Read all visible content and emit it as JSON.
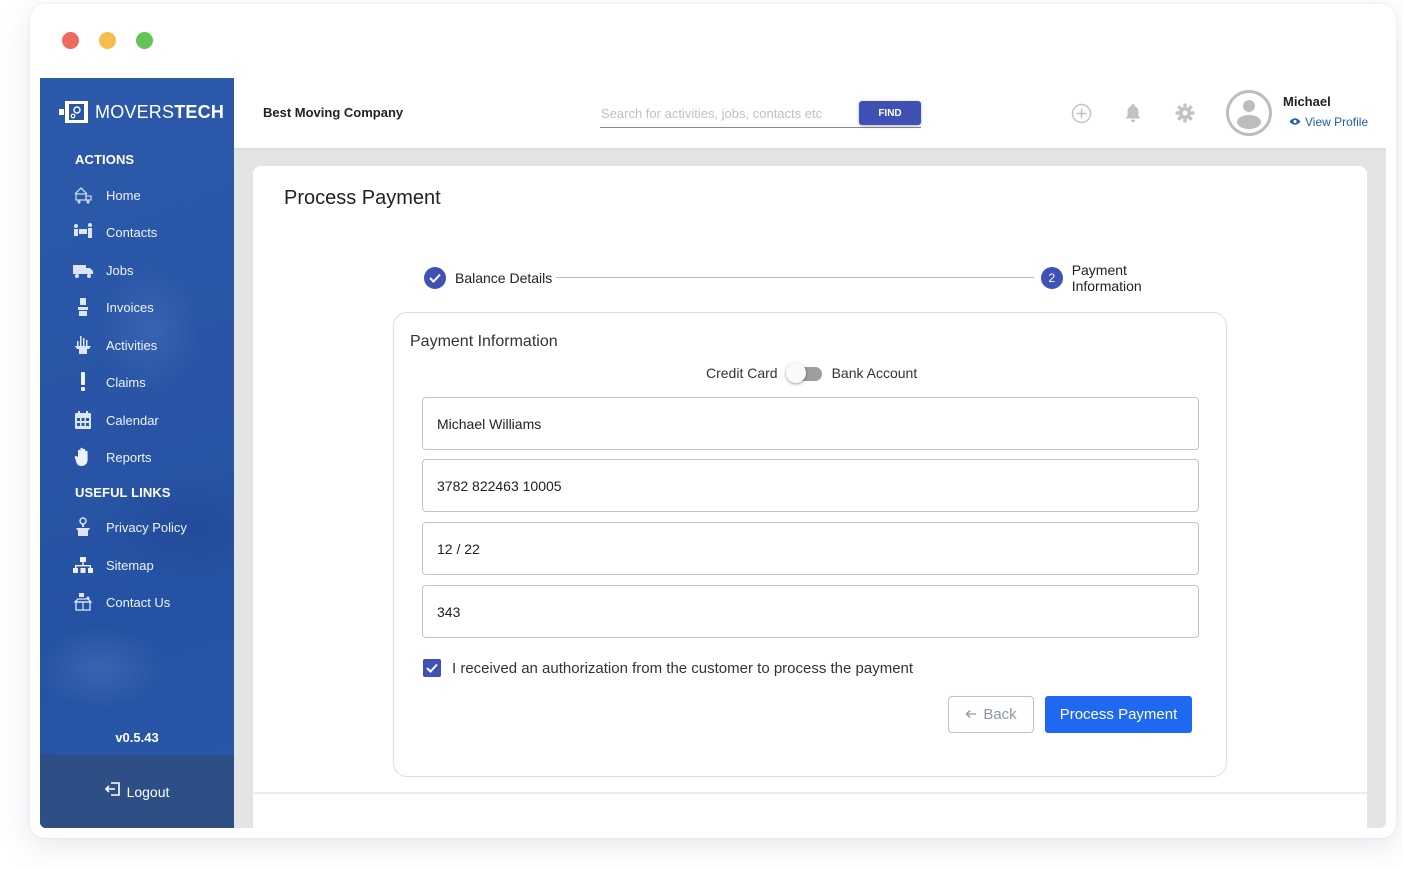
{
  "window": {
    "controls": [
      "close",
      "minimize",
      "maximize"
    ]
  },
  "brand": {
    "name_light": "MOVERS",
    "name_bold": "TECH"
  },
  "sidebar": {
    "actions_title": "ACTIONS",
    "actions": [
      {
        "label": "Home",
        "icon": "home-truck-icon"
      },
      {
        "label": "Contacts",
        "icon": "contacts-movers-icon"
      },
      {
        "label": "Jobs",
        "icon": "truck-icon"
      },
      {
        "label": "Invoices",
        "icon": "invoice-box-icon"
      },
      {
        "label": "Activities",
        "icon": "activities-icon"
      },
      {
        "label": "Claims",
        "icon": "exclamation-icon"
      },
      {
        "label": "Calendar",
        "icon": "calendar-icon"
      },
      {
        "label": "Reports",
        "icon": "hand-icon"
      }
    ],
    "links_title": "USEFUL LINKS",
    "links": [
      {
        "label": "Privacy Policy",
        "icon": "privacy-box-icon"
      },
      {
        "label": "Sitemap",
        "icon": "sitemap-icon"
      },
      {
        "label": "Contact Us",
        "icon": "contact-box-icon"
      }
    ],
    "version": "v0.5.43",
    "logout_label": "Logout"
  },
  "topbar": {
    "company": "Best Moving Company",
    "search": {
      "placeholder": "Search for activities, jobs, contacts etc",
      "value": ""
    },
    "find_label": "FIND",
    "user": {
      "name": "Michael",
      "view_profile": "View Profile"
    }
  },
  "main": {
    "title": "Process Payment",
    "steps": [
      {
        "label": "Balance Details",
        "status": "completed",
        "number": "1"
      },
      {
        "label": "Payment Information",
        "status": "active",
        "number": "2"
      }
    ],
    "payment": {
      "title": "Payment Information",
      "toggle": {
        "left_label": "Credit Card",
        "right_label": "Bank Account",
        "selected": "Credit Card"
      },
      "fields": [
        {
          "name": "cardholder-name",
          "value": "Michael Williams"
        },
        {
          "name": "card-number",
          "value": "3782 822463 10005"
        },
        {
          "name": "expiry-date",
          "value": "12 / 22"
        },
        {
          "name": "cvc",
          "value": "343"
        }
      ],
      "authorization": {
        "label": "I received an authorization from the customer to process the payment",
        "checked": true
      },
      "back_label": "Back",
      "submit_label": "Process Payment"
    }
  },
  "colors": {
    "sidebar_blue": "#2a55a6",
    "primary_indigo": "#3f51b5",
    "process_blue": "#1e68f2",
    "link_blue": "#1f5ea8"
  }
}
